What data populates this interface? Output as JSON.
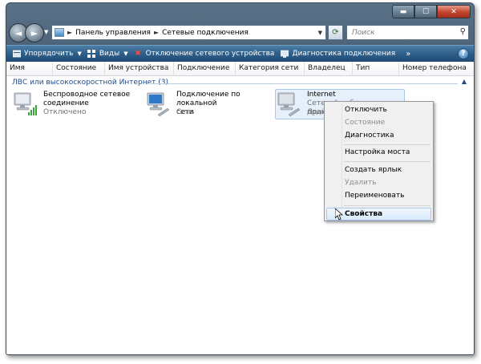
{
  "window": {
    "caption_buttons": {
      "minimize": "▬",
      "maximize": "☐",
      "close": "✕"
    }
  },
  "navbar": {
    "back_glyph": "◄",
    "forward_glyph": "►",
    "breadcrumb": [
      "Панель управления",
      "Сетевые подключения"
    ],
    "search_placeholder": "Поиск"
  },
  "toolbar": {
    "organize": "Упорядочить",
    "views": "Виды",
    "disable": "Отключение сетевого устройства",
    "diagnose": "Диагностика подключения",
    "more": "»",
    "help": "?"
  },
  "columns": [
    "Имя",
    "Состояние",
    "Имя устройства",
    "Подключение",
    "Категория сети",
    "Владелец",
    "Тип",
    "Номер телефона"
  ],
  "group": {
    "label": "ЛВС или высокоскоростной Интернет (3)"
  },
  "connections": [
    {
      "name_line1": "Беспроводное сетевое",
      "name_line2": "соединение",
      "status": "Отключено",
      "icon": "wireless-network-icon"
    },
    {
      "name_line1": "Подключение по локальной",
      "name_line2": "сети",
      "status": "Сеть",
      "icon": "lan-network-icon"
    },
    {
      "name_line1": "Internet",
      "name_line2": "Сетевой кабель не подключен",
      "status": "Драйвер",
      "icon": "network-adapter-icon"
    }
  ],
  "context_menu": {
    "items": [
      {
        "label": "Отключить",
        "enabled": true
      },
      {
        "label": "Состояние",
        "enabled": false
      },
      {
        "label": "Диагностика",
        "enabled": true
      },
      {
        "label": "Настройка моста",
        "enabled": true
      },
      {
        "label": "Создать ярлык",
        "enabled": true
      },
      {
        "label": "Удалить",
        "enabled": false
      },
      {
        "label": "Переименовать",
        "enabled": true
      },
      {
        "label": "Свойства",
        "enabled": true,
        "highlighted": true,
        "bold": true
      }
    ]
  },
  "colors": {
    "toolbar_blue": "#2f5f89",
    "group_text": "#1e4b8f",
    "highlight": "#d7e9fb"
  }
}
